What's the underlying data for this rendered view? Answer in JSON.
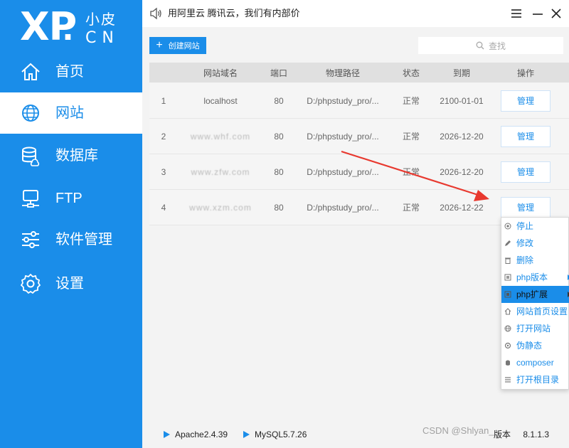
{
  "logo": {
    "main": "XP",
    "dot": ".",
    "small": "小皮",
    "cn": "CN"
  },
  "sidebar": {
    "items": [
      {
        "label": "首页",
        "icon": "home-icon"
      },
      {
        "label": "网站",
        "icon": "globe-icon"
      },
      {
        "label": "数据库",
        "icon": "database-icon"
      },
      {
        "label": "FTP",
        "icon": "ftp-icon"
      },
      {
        "label": "软件管理",
        "icon": "sliders-icon"
      },
      {
        "label": "设置",
        "icon": "gear-icon"
      }
    ],
    "active": "网站"
  },
  "titlebar": {
    "notice": "用阿里云 腾讯云，我们有内部价"
  },
  "toolbar": {
    "create_label": "创建网站",
    "search_placeholder": "查找"
  },
  "table": {
    "headers": [
      "网站域名",
      "端口",
      "物理路径",
      "状态",
      "到期",
      "操作"
    ],
    "rows": [
      {
        "num": "1",
        "domain": "localhost",
        "port": "80",
        "path": "D:/phpstudy_pro/...",
        "status": "正常",
        "expire": "2100-01-01",
        "action": "管理"
      },
      {
        "num": "2",
        "domain": "www.whf.com",
        "port": "80",
        "path": "D:/phpstudy_pro/...",
        "status": "正常",
        "expire": "2026-12-20",
        "action": "管理"
      },
      {
        "num": "3",
        "domain": "www.zfw.com",
        "port": "80",
        "path": "D:/phpstudy_pro/...",
        "status": "正常",
        "expire": "2026-12-20",
        "action": "管理"
      },
      {
        "num": "4",
        "domain": "www.xzm.com",
        "port": "80",
        "path": "D:/phpstudy_pro/...",
        "status": "正常",
        "expire": "2026-12-22",
        "action": "管理"
      }
    ]
  },
  "context_menu": {
    "items": [
      {
        "label": "停止",
        "icon": "stop-icon"
      },
      {
        "label": "修改",
        "icon": "pencil-icon"
      },
      {
        "label": "删除",
        "icon": "trash-icon"
      },
      {
        "label": "php版本",
        "icon": "php-icon",
        "submenu": true
      },
      {
        "label": "php扩展",
        "icon": "extension-icon",
        "submenu": true,
        "highlighted": true
      },
      {
        "label": "网站首页设置",
        "icon": "home-small-icon"
      },
      {
        "label": "打开网站",
        "icon": "globe-small-icon"
      },
      {
        "label": "伪静态",
        "icon": "rewrite-icon"
      },
      {
        "label": "composer",
        "icon": "composer-icon"
      },
      {
        "label": "打开根目录",
        "icon": "folder-list-icon"
      }
    ]
  },
  "statusbar": {
    "services": [
      "Apache2.4.39",
      "MySQL5.7.26"
    ],
    "version_label": "版本",
    "version": "8.1.1.3"
  },
  "watermark": "CSDN @Shlyan_"
}
